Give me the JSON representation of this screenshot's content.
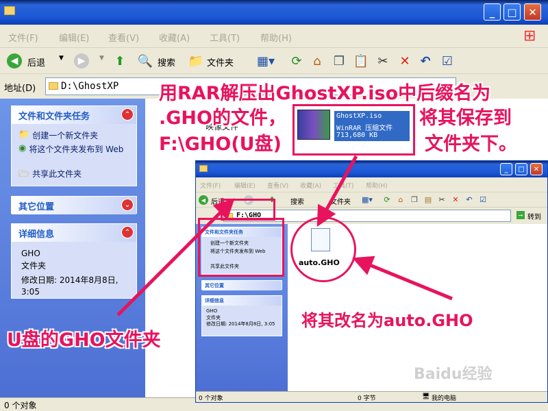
{
  "main_window": {
    "menu": [
      "文件(F)",
      "编辑(E)",
      "查看(V)",
      "收藏(A)",
      "工具(T)",
      "帮助(H)"
    ],
    "toolbar": {
      "back": "后退",
      "search": "搜索",
      "folders": "文件夹"
    },
    "address_label": "地址(D)",
    "address_value": "D:\\GhostXP",
    "tasks_panel": {
      "title": "文件和文件夹任务",
      "items": [
        "创建一个新文件夹",
        "将这个文件夹发布到 Web",
        "共享此文件夹"
      ]
    },
    "other_panel": {
      "title": "其它位置"
    },
    "details_panel": {
      "title": "详细信息",
      "name": "GHO",
      "type": "文件夹",
      "modified": "修改日期: 2014年8月8日, 3:05"
    },
    "partial_text": "映像文件",
    "status": "0 个对象"
  },
  "archive_file": {
    "name": "GhostXP.iso",
    "type": "WinRAR 压缩文件",
    "size": "713,680 KB"
  },
  "inner_window": {
    "menu": [
      "文件(F)",
      "编辑(E)",
      "查看(V)",
      "收藏(A)",
      "工具(T)",
      "帮助(H)"
    ],
    "toolbar": {
      "back": "后退",
      "search": "搜索",
      "folders": "文件夹"
    },
    "address_value": "F:\\GHO",
    "go_label": "转到",
    "tasks_panel": {
      "title": "文件和文件夹任务",
      "items": [
        "创建一个新文件夹",
        "将这个文件夹发布到 Web",
        "共享此文件夹"
      ]
    },
    "other_panel": {
      "title": "其它位置"
    },
    "details_panel": {
      "title": "详细信息",
      "name": "GHO",
      "type": "文件夹",
      "modified": "修改日期: 2014年8月8日, 3:05"
    },
    "file_name": "auto.GHO",
    "status": [
      "0 个对象",
      "0 字节",
      "我的电脑"
    ]
  },
  "annotations": {
    "top_line1": "用RAR解压出GhostXP.iso中后缀名为",
    "top_line2": ".GHO的文件，",
    "top_line3": "F:\\GHO(U盘)",
    "save_line1": "将其保存到",
    "save_line2": "文件夹下。",
    "rename": "将其改名为auto.GHO",
    "usb_folder": "U盘的GHO文件夹"
  },
  "watermark": "Baidu经验",
  "colors": {
    "callout": "#e8135d",
    "xp_blue": "#0c3fb4"
  }
}
